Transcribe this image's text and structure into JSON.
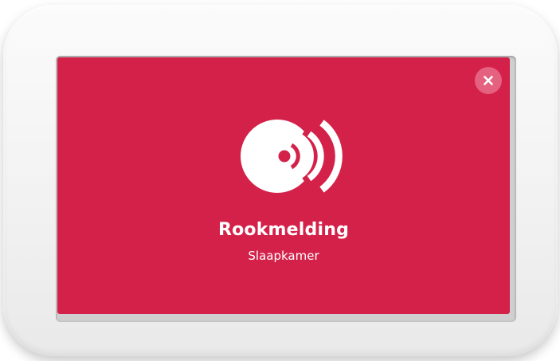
{
  "alarm": {
    "title": "Rookmelding",
    "location": "Slaapkamer",
    "icon": "smoke-detector-alarm-icon"
  },
  "close": {
    "icon": "close-icon"
  },
  "colors": {
    "screen_background": "#d4214a",
    "close_button_background": "#e4617f",
    "foreground": "#ffffff",
    "device_frame": "#f2f2f2"
  }
}
